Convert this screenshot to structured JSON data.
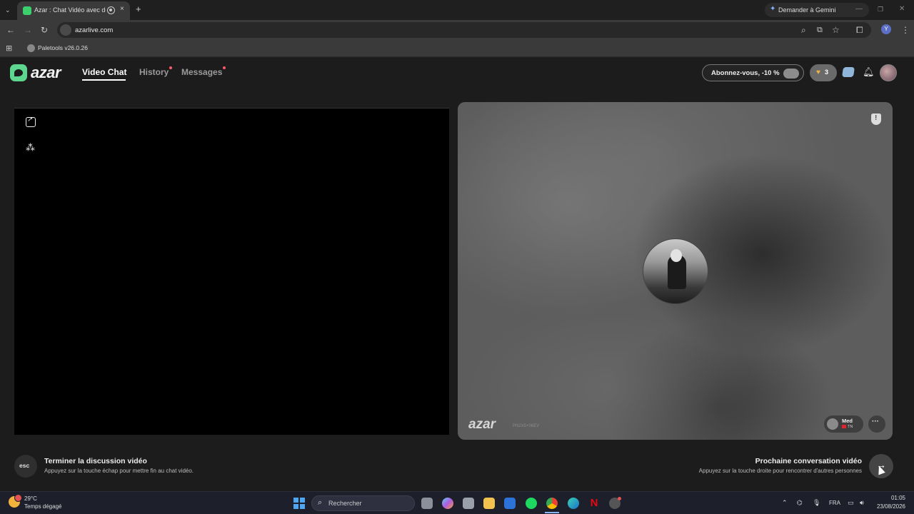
{
  "browser": {
    "tab_title": "Azar : Chat Vidéo avec de n",
    "tab_close": "×",
    "new_tab": "+",
    "gemini_label": "Demander à Gemini",
    "url": "azarlive.com",
    "bookmark_label": "Paletools v26.0.26",
    "profile_initial": "Y"
  },
  "app": {
    "logo_text": "azar",
    "nav": [
      {
        "label": "Video Chat",
        "active": true
      },
      {
        "label": "History",
        "dot": true
      },
      {
        "label": "Messages",
        "dot": true
      }
    ],
    "subscribe_label": "Abonnez-vous, -10 %",
    "coins": "3",
    "remote": {
      "watermark": "azar",
      "session_id": "PN2X5+06EV",
      "peer_name": "Med",
      "peer_country": "TN"
    },
    "end_hint": {
      "key": "esc",
      "title": "Terminer la discussion vidéo",
      "subtitle": "Appuyez sur la touche échap pour mettre fin au chat vidéo."
    },
    "next_hint": {
      "title": "Prochaine conversation vidéo",
      "subtitle": "Appuyez sur la touche droite pour rencontrer d'autres personnes",
      "arrow": "→"
    },
    "colors": {
      "brand": "#5ed68f",
      "notification_dot": "#ff5a6a"
    }
  },
  "taskbar": {
    "temperature": "29°C",
    "weather": "Temps dégagé",
    "search_placeholder": "Rechercher",
    "language": "FRA",
    "time": "01:05",
    "date": "23/08/2026"
  }
}
